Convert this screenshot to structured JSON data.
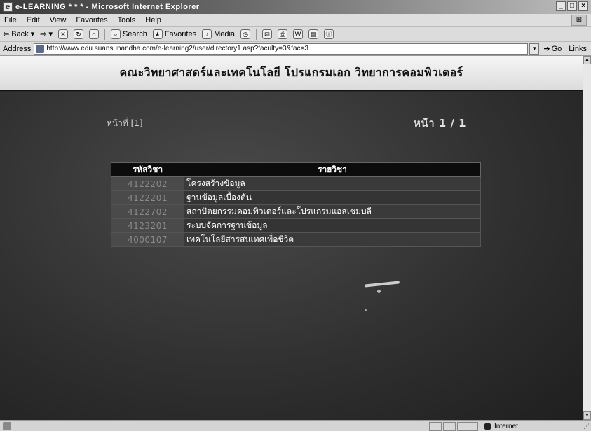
{
  "window": {
    "title": "e-LEARNING * * * - Microsoft Internet Explorer",
    "controls": [
      "_",
      "□",
      "×"
    ]
  },
  "menubar": {
    "items": [
      "File",
      "Edit",
      "View",
      "Favorites",
      "Tools",
      "Help"
    ]
  },
  "toolbar": {
    "back": "Back",
    "search": "Search",
    "favorites": "Favorites",
    "media": "Media"
  },
  "address": {
    "label": "Address",
    "url": "http://www.edu.suansunandha.com/e-learning2/user/directory1.asp?faculty=3&fac=3",
    "go": "Go",
    "links": "Links"
  },
  "page": {
    "title": "คณะวิทยาศาสตร์และเทคโนโลยี โปรแกรมเอก วิทยาการคอมพิวเตอร์",
    "nav_prefix": "หน้าที่",
    "nav_link": "[1]",
    "page_count": "หน้า 1 / 1"
  },
  "table": {
    "headers": [
      "รหัสวิชา",
      "รายวิชา"
    ],
    "rows": [
      {
        "code": "4122202",
        "name": "โครงสร้างข้อมูล"
      },
      {
        "code": "4122201",
        "name": "ฐานข้อมูลเบื้องต้น"
      },
      {
        "code": "4122702",
        "name": "สถาปัตยกรรมคอมพิวเตอร์และโปรแกรมแอสเซมบลี"
      },
      {
        "code": "4123201",
        "name": "ระบบจัดการฐานข้อมูล"
      },
      {
        "code": "4000107",
        "name": "เทคโนโลยีสารสนเทศเพื่อชีวิต"
      }
    ]
  },
  "status": {
    "zone": "Internet"
  }
}
